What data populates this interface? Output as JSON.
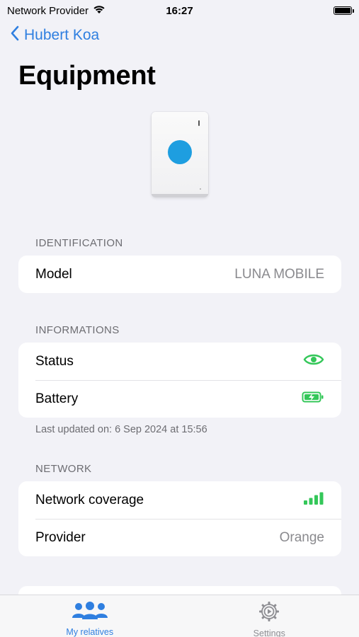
{
  "status_bar": {
    "carrier": "Network Provider",
    "time": "16:27"
  },
  "nav": {
    "back_label": "Hubert Koa"
  },
  "page": {
    "title": "Equipment"
  },
  "identification": {
    "header": "IDENTIFICATION",
    "rows": [
      {
        "label": "Model",
        "value": "LUNA MOBILE"
      }
    ]
  },
  "informations": {
    "header": "INFORMATIONS",
    "rows": [
      {
        "label": "Status",
        "icon": "eye-icon"
      },
      {
        "label": "Battery",
        "icon": "battery-charging-icon"
      }
    ],
    "footnote": "Last updated on: 6 Sep 2024 at 15:56"
  },
  "network": {
    "header": "NETWORK",
    "rows": [
      {
        "label": "Network coverage",
        "icon": "signal-bars-icon"
      },
      {
        "label": "Provider",
        "value": "Orange"
      }
    ]
  },
  "tab_bar": {
    "tabs": [
      {
        "label": "My relatives",
        "icon": "people-icon",
        "active": true
      },
      {
        "label": "Settings",
        "icon": "gear-icon",
        "active": false
      }
    ]
  },
  "colors": {
    "accent": "#2f7fe0",
    "status_green": "#34c759",
    "device_button": "#1e9ee0"
  }
}
